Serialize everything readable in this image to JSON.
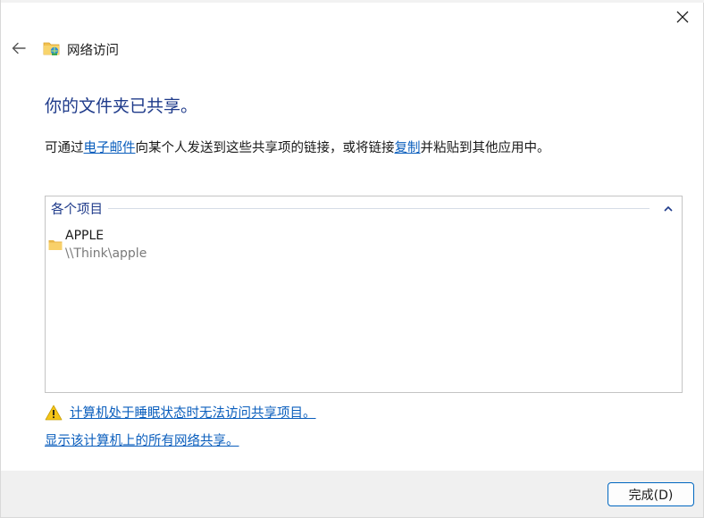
{
  "header": {
    "title": "网络访问"
  },
  "main": {
    "heading": "你的文件夹已共享。",
    "description": {
      "part1": "可通过",
      "email_link": "电子邮件",
      "part2": "向某个人发送到这些共享项的链接，或将链接",
      "copy_link": "复制",
      "part3": "并粘贴到其他应用中。"
    },
    "items_group": {
      "label": "各个项目",
      "items": [
        {
          "name": "APPLE",
          "path": "\\\\Think\\apple"
        }
      ]
    },
    "sleep_warning_link": "计算机处于睡眠状态时无法访问共享项目。",
    "show_all_shares_link": "显示该计算机上的所有网络共享。"
  },
  "footer": {
    "done_label": "完成(D)"
  },
  "colors": {
    "heading": "#1e3a8a",
    "link": "#0a5ebd",
    "accent": "#0067c0",
    "footer_bg": "#f0f0f0"
  },
  "icons": {
    "close": "close-icon",
    "back": "back-arrow-icon",
    "network": "network-folder-icon",
    "collapse": "chevron-up-icon",
    "folder": "folder-icon",
    "warning": "warning-icon"
  }
}
